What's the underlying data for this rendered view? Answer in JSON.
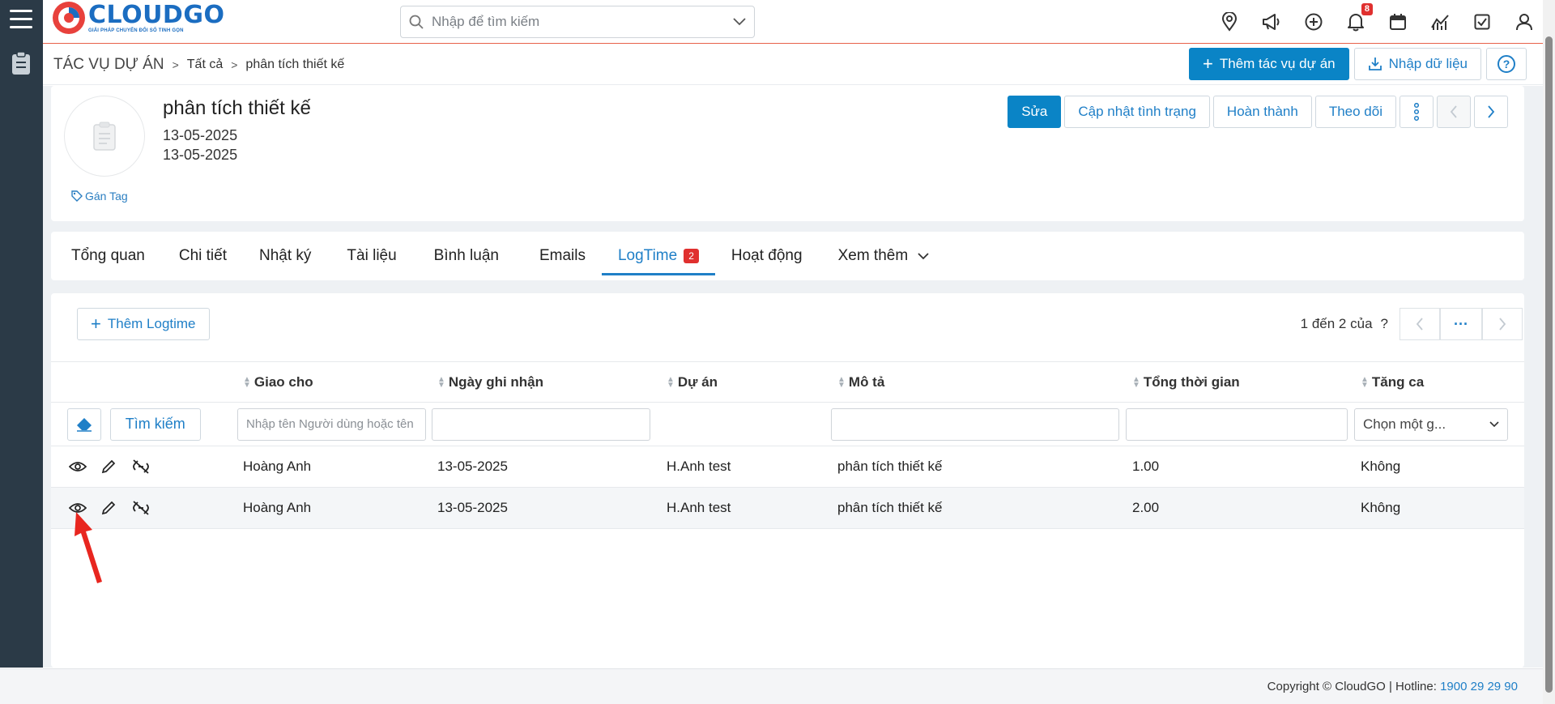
{
  "brand": {
    "name": "CLOUDGO",
    "tagline": "GIẢI PHÁP CHUYỂN ĐỔI SỐ TINH GỌN"
  },
  "search": {
    "placeholder": "Nhập để tìm kiếm"
  },
  "top_icons": [
    "map-pin-icon",
    "megaphone-icon",
    "plus-circle-icon",
    "bell-icon",
    "calendar-icon",
    "chart-icon",
    "checkbox-icon",
    "user-icon"
  ],
  "notifications_count": "8",
  "breadcrumb": {
    "root": "TÁC VỤ DỰ ÁN",
    "level1": "Tất cả",
    "level2": "phân tích thiết kế"
  },
  "header_actions": {
    "add": "Thêm tác vụ dự án",
    "import": "Nhập dữ liệu",
    "help": "?"
  },
  "record": {
    "title": "phân tích thiết kế",
    "date1": "13-05-2025",
    "date2": "13-05-2025",
    "tag_label": "Gán Tag",
    "actions": {
      "edit": "Sửa",
      "update_status": "Cập nhật tình trạng",
      "complete": "Hoàn thành",
      "follow": "Theo dõi"
    }
  },
  "tabs": [
    {
      "label": "Tổng quan"
    },
    {
      "label": "Chi tiết"
    },
    {
      "label": "Nhật ký"
    },
    {
      "label": "Tài liệu"
    },
    {
      "label": "Bình luận"
    },
    {
      "label": "Emails"
    },
    {
      "label": "LogTime",
      "count": "2",
      "active": true
    },
    {
      "label": "Hoạt động"
    },
    {
      "label": "Xem thêm"
    }
  ],
  "logtime": {
    "add_label": "Thêm Logtime",
    "pager_text": "1 đến 2 của",
    "pager_help": "?",
    "pager_more": "···",
    "search_button": "Tìm kiếm",
    "columns": [
      "Giao cho",
      "Ngày ghi nhận",
      "Dự án",
      "Mô tả",
      "Tổng thời gian",
      "Tăng ca"
    ],
    "filter_placeholder_assignee": "Nhập tên Người dùng hoặc tên",
    "filter_select": "Chọn một g...",
    "rows": [
      {
        "assignee": "Hoàng Anh",
        "date": "13-05-2025",
        "project": "H.Anh test",
        "description": "phân tích thiết kế",
        "total": "1.00",
        "overtime": "Không"
      },
      {
        "assignee": "Hoàng Anh",
        "date": "13-05-2025",
        "project": "H.Anh test",
        "description": "phân tích thiết kế",
        "total": "2.00",
        "overtime": "Không"
      }
    ]
  },
  "footer": {
    "copyright": "Copyright © CloudGO",
    "hotline_label": "Hotline:",
    "hotline": "1900 29 29 90"
  },
  "colors": {
    "primary": "#0a84c6",
    "link": "#1f7fc7",
    "rail": "#2b3a47",
    "badge": "#e0302f",
    "annotation_arrow": "#e8261f"
  }
}
